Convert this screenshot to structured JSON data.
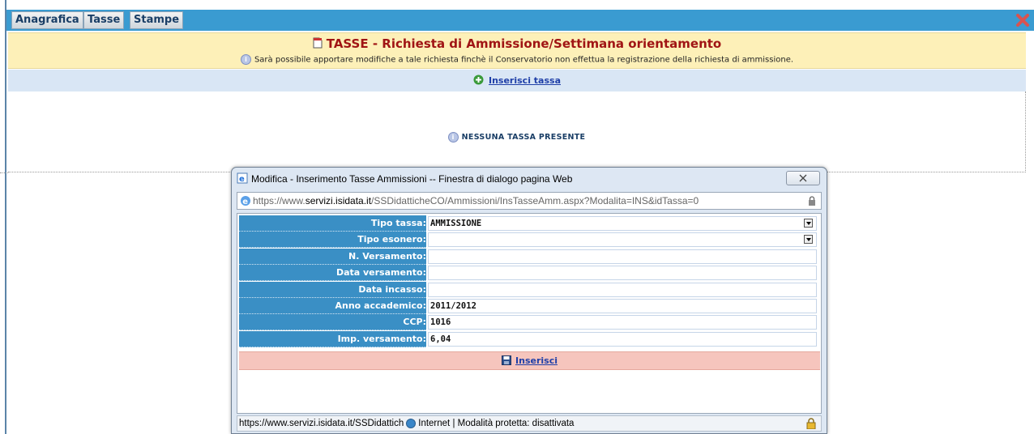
{
  "tabs": [
    "Anagrafica",
    "Tasse",
    "Stampe"
  ],
  "header": {
    "title": "TASSE - Richiesta di Ammissione/Settimana orientamento",
    "subtitle": "Sarà possibile apportare modifiche a tale richiesta finchè il Conservatorio non effettua la registrazione della richiesta di ammissione."
  },
  "insert_link": "Inserisci tassa",
  "empty_message": "NESSUNA TASSA PRESENTE",
  "dialog": {
    "title": "Modifica - Inserimento Tasse Ammissioni -- Finestra di dialogo pagina Web",
    "url_prefix": "https://www.",
    "url_domain": "servizi.isidata.it",
    "url_rest": "/SSDidatticheCO/Ammissioni/InsTasseAmm.aspx?Modalita=INS&idTassa=0",
    "fields": [
      {
        "label": "Tipo tassa:",
        "value": "AMMISSIONE",
        "type": "select"
      },
      {
        "label": "Tipo esonero:",
        "value": "",
        "type": "select"
      },
      {
        "label": "N. Versamento:",
        "value": "",
        "type": "text"
      },
      {
        "label": "Data versamento:",
        "value": "",
        "type": "text"
      },
      {
        "label": "Data incasso:",
        "value": "",
        "type": "text"
      },
      {
        "label": "Anno accademico:",
        "value": "2011/2012",
        "type": "text"
      },
      {
        "label": "CCP:",
        "value": "1016",
        "type": "text"
      },
      {
        "label": "Imp. versamento:",
        "value": "6,04",
        "type": "text"
      }
    ],
    "save_label": "Inserisci",
    "status_url": "https://www.servizi.isidata.it/SSDidattich",
    "status_zone": "Internet | Modalità protetta: disattivata"
  },
  "colors": {
    "topbar": "#3a9bd1",
    "header_bg": "#fdf0b8",
    "title_red": "#a01414",
    "label_blue": "#3a8fc5",
    "save_bar": "#f6c5bd"
  }
}
